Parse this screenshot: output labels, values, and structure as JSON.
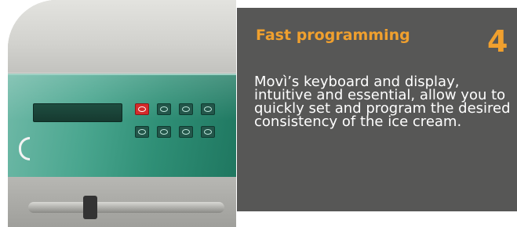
{
  "photo": {
    "icon": "ice-cream-machine-keypad-photo"
  },
  "info": {
    "title": "Fast programming",
    "number": "4",
    "description": "Movì’s keyboard and display, intuitive and essential, allow you to quickly set and program the desired consistency of the ice cream."
  },
  "colors": {
    "panel_background": "#575756",
    "accent": "#f0a02e",
    "text": "#ffffff",
    "keypad_green": "#2f8f76",
    "power_red": "#d52b2b"
  }
}
